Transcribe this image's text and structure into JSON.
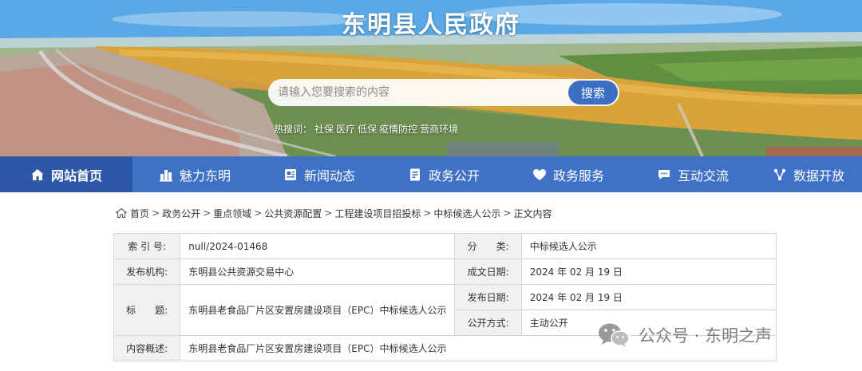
{
  "header": {
    "site_title": "东明县人民政府",
    "search": {
      "placeholder": "请输入您要搜索的内容",
      "button_label": "搜索"
    },
    "hot_words": {
      "label": "热搜词：",
      "items": [
        "社保",
        "医疗",
        "低保",
        "疫情防控",
        "营商环境"
      ]
    }
  },
  "nav": {
    "items": [
      {
        "label": "网站首页",
        "icon": "home-icon",
        "active": true
      },
      {
        "label": "魅力东明",
        "icon": "city-icon",
        "active": false
      },
      {
        "label": "新闻动态",
        "icon": "news-icon",
        "active": false
      },
      {
        "label": "政务公开",
        "icon": "document-icon",
        "active": false
      },
      {
        "label": "政务服务",
        "icon": "heart-icon",
        "active": false
      },
      {
        "label": "互动交流",
        "icon": "chat-icon",
        "active": false
      },
      {
        "label": "数据开放",
        "icon": "data-icon",
        "active": false
      }
    ]
  },
  "breadcrumb": {
    "items": [
      "首页",
      "政务公开",
      "重点领域",
      "公共资源配置",
      "工程建设项目招投标",
      "中标候选人公示",
      "正文内容"
    ],
    "separator": ">"
  },
  "info_table": {
    "index_no": {
      "label": "索 引 号:",
      "value": "null/2024-01468"
    },
    "category": {
      "label": "分　　类:",
      "value": "中标候选人公示"
    },
    "publisher": {
      "label": "发布机构:",
      "value": "东明县公共资源交易中心"
    },
    "created_date": {
      "label": "成文日期:",
      "value": "2024 年 02 月 19 日"
    },
    "title": {
      "label": "标　　题:",
      "value": "东明县老食品厂片区安置房建设项目（EPC）中标候选人公示"
    },
    "publish_date": {
      "label": "发布日期:",
      "value": "2024 年 02 月 19 日"
    },
    "disclosure": {
      "label": "公开方式:",
      "value": "主动公开"
    },
    "summary": {
      "label": "内容概述:",
      "value": "东明县老食品厂片区安置房建设项目（EPC）中标候选人公示"
    }
  },
  "watermark": {
    "text": "公众号 · 东明之声",
    "icon": "wechat-icon"
  },
  "colors": {
    "nav_bg": "#3f72c6",
    "nav_active": "#2d58a8",
    "search_button": "#3a6fc4",
    "table_label_bg": "#f1f1f1",
    "table_border": "#d6d6d6"
  }
}
